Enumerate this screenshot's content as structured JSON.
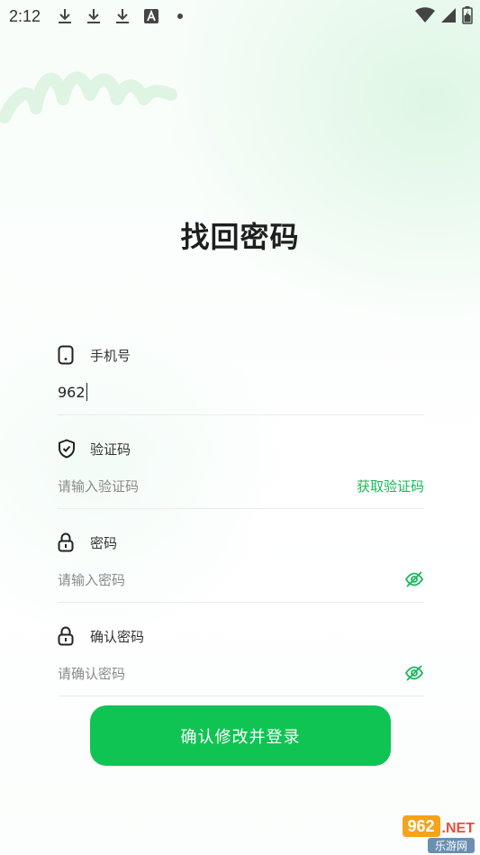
{
  "status_bar": {
    "time": "2:12",
    "icons": [
      "download-icon",
      "download-icon",
      "download-icon",
      "font-a-icon",
      "dot-icon"
    ],
    "right_icons": [
      "wifi-icon",
      "cell-signal-icon",
      "battery-icon"
    ]
  },
  "page": {
    "title": "找回密码"
  },
  "fields": {
    "phone": {
      "label": "手机号",
      "value": "962",
      "icon": "phone-icon"
    },
    "code": {
      "label": "验证码",
      "placeholder": "请输入验证码",
      "action": "获取验证码",
      "icon": "shield-check-icon"
    },
    "password": {
      "label": "密码",
      "placeholder": "请输入密码",
      "icon": "lock-icon",
      "toggle": "eye-off-icon"
    },
    "confirm": {
      "label": "确认密码",
      "placeholder": "请确认密码",
      "icon": "lock-icon",
      "toggle": "eye-off-icon"
    }
  },
  "submit": {
    "label": "确认修改并登录"
  },
  "colors": {
    "accent": "#10c454",
    "link": "#1bb75a"
  },
  "watermark": {
    "logo": "962",
    "suffix": ".NET",
    "sub": "乐游网"
  }
}
